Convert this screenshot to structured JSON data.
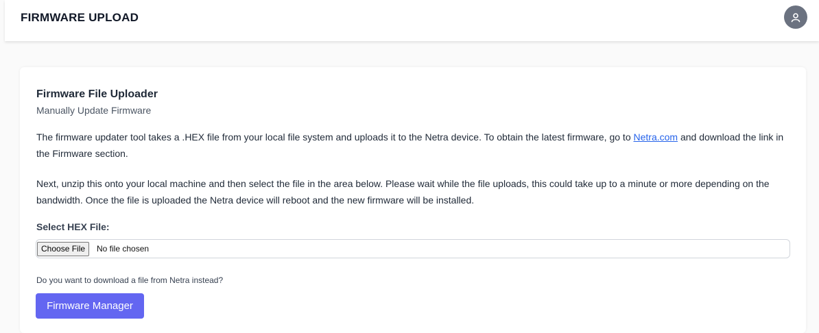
{
  "header": {
    "title": "FIRMWARE UPLOAD",
    "avatar_icon": "user-icon"
  },
  "card": {
    "title": "Firmware File Uploader",
    "subtitle": "Manually Update Firmware",
    "paragraph1_before_link": "The firmware updater tool takes a .HEX file from your local file system and uploads it to the Netra device. To obtain the latest firmware, go to ",
    "paragraph1_link": "Netra.com",
    "paragraph1_after_link": " and download the link in the Firmware section.",
    "paragraph2": "Next, unzip this onto your local machine and then select the file in the area below. Please wait while the file uploads, this could take up to a minute or more depending on the bandwidth. Once the file is uploaded the Netra device will reboot and the new firmware will be installed.",
    "select_label": "Select HEX File:",
    "file_input": {
      "button_label": "Choose File",
      "status": "No file chosen"
    },
    "download_question": "Do you want to download a file from Netra instead?",
    "firmware_manager_button": "Firmware Manager"
  },
  "colors": {
    "accent": "#6366f1",
    "link": "#2563eb",
    "avatar_bg": "#6b7280"
  }
}
